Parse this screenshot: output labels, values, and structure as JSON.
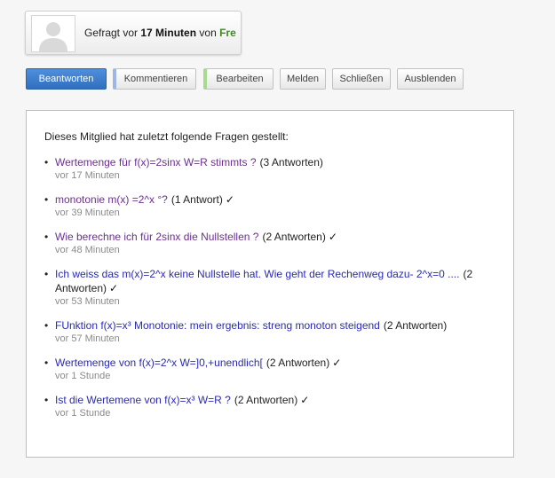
{
  "asked": {
    "prefix": "Gefragt vor",
    "time": "17 Minuten",
    "by": "von",
    "user": "Fre",
    "user_color": "#3a8c1c"
  },
  "buttons": [
    {
      "label": "Beantworten"
    },
    {
      "label": "Kommentieren"
    },
    {
      "label": "Bearbeiten"
    },
    {
      "label": "Melden"
    },
    {
      "label": "Schließen"
    },
    {
      "label": "Ausblenden"
    }
  ],
  "panel": {
    "intro": "Dieses Mitglied hat zuletzt folgende Fragen gestellt:",
    "questions": [
      {
        "title": "Wertemenge für f(x)=2sinx W=R stimmts ?",
        "answers": "(3 Antworten)",
        "checked": false,
        "time": "vor 17 Minuten",
        "visited": true
      },
      {
        "title": "monotonie m(x) =2^x °?",
        "answers": "(1 Antwort)",
        "checked": true,
        "time": "vor 39 Minuten",
        "visited": true
      },
      {
        "title": "Wie berechne ich für 2sinx die Nullstellen ?",
        "answers": "(2 Antworten)",
        "checked": true,
        "time": "vor 48 Minuten",
        "visited": true
      },
      {
        "title": "Ich weiss das m(x)=2^x keine Nullstelle hat. Wie geht der Rechenweg dazu- 2^x=0 ....",
        "answers": "(2 Antworten)",
        "checked": true,
        "time": "vor 53 Minuten",
        "visited": false
      },
      {
        "title": "FUnktion f(x)=x³ Monotonie: mein ergebnis: streng monoton steigend",
        "answers": "(2 Antworten)",
        "checked": false,
        "time": "vor 57 Minuten",
        "visited": false
      },
      {
        "title": "Wertemenge von f(x)=2^x W=]0,+unendlich[",
        "answers": "(2 Antworten)",
        "checked": true,
        "time": "vor 1 Stunde",
        "visited": false
      },
      {
        "title": "Ist die Wertemene von f(x)=x³ W=R ?",
        "answers": "(2 Antworten)",
        "checked": true,
        "time": "vor 1 Stunde",
        "visited": false
      }
    ],
    "check_glyph": "✓",
    "bullet_glyph": "•"
  },
  "icons": {
    "avatar": "user-silhouette-icon"
  }
}
